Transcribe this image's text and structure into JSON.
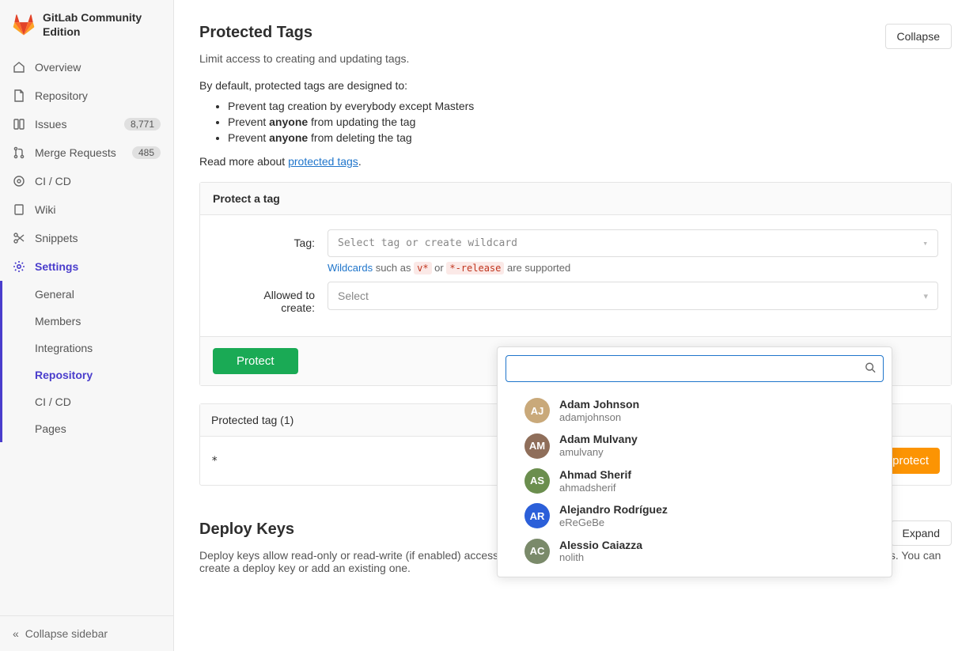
{
  "brand": "GitLab Community Edition",
  "sidebar": {
    "items": [
      {
        "label": "Overview",
        "badge": null
      },
      {
        "label": "Repository",
        "badge": null
      },
      {
        "label": "Issues",
        "badge": "8,771"
      },
      {
        "label": "Merge Requests",
        "badge": "485"
      },
      {
        "label": "CI / CD",
        "badge": null
      },
      {
        "label": "Wiki",
        "badge": null
      },
      {
        "label": "Snippets",
        "badge": null
      },
      {
        "label": "Settings",
        "badge": null
      }
    ],
    "subnav": [
      "General",
      "Members",
      "Integrations",
      "Repository",
      "CI / CD",
      "Pages"
    ],
    "collapse_label": "Collapse sidebar"
  },
  "protected_tags": {
    "title": "Protected Tags",
    "collapse_btn": "Collapse",
    "subtitle": "Limit access to creating and updating tags.",
    "intro": "By default, protected tags are designed to:",
    "bullets": [
      {
        "pre": "Prevent tag creation by everybody except Masters",
        "bold": ""
      },
      {
        "pre": "Prevent ",
        "bold": "anyone",
        "post": " from updating the tag"
      },
      {
        "pre": "Prevent ",
        "bold": "anyone",
        "post": " from deleting the tag"
      }
    ],
    "readmore_pre": "Read more about ",
    "readmore_link": "protected tags",
    "panel_title": "Protect a tag",
    "tag_label": "Tag:",
    "tag_placeholder": "Select tag or create wildcard",
    "hint_link": "Wildcards",
    "hint_mid": " such as ",
    "hint_code1": "v*",
    "hint_or": " or ",
    "hint_code2": "*-release",
    "hint_end": " are supported",
    "allowed_label_l1": "Allowed to",
    "allowed_label_l2": "create:",
    "allowed_placeholder": "Select",
    "protect_btn": "Protect",
    "table_head": "Protected tag (1)",
    "tag_row": "*",
    "unprotect_btn": "Unprotect"
  },
  "dropdown": {
    "search_placeholder": "",
    "users": [
      {
        "name": "Adam Johnson",
        "username": "adamjohnson",
        "avatar_bg": "#c9a97a"
      },
      {
        "name": "Adam Mulvany",
        "username": "amulvany",
        "avatar_bg": "#8f6e5a"
      },
      {
        "name": "Ahmad Sherif",
        "username": "ahmadsherif",
        "avatar_bg": "#6b8e4e"
      },
      {
        "name": "Alejandro Rodríguez",
        "username": "eReGeBe",
        "avatar_bg": "#2b5fd9"
      },
      {
        "name": "Alessio Caiazza",
        "username": "nolith",
        "avatar_bg": "#7a8a6a"
      }
    ]
  },
  "deploy": {
    "title": "Deploy Keys",
    "expand_btn": "Expand",
    "subtitle": "Deploy keys allow read-only or read-write (if enabled) access to your repository. Deploy keys can be used for CI, staging or production servers. You can create a deploy key or add an existing one."
  }
}
